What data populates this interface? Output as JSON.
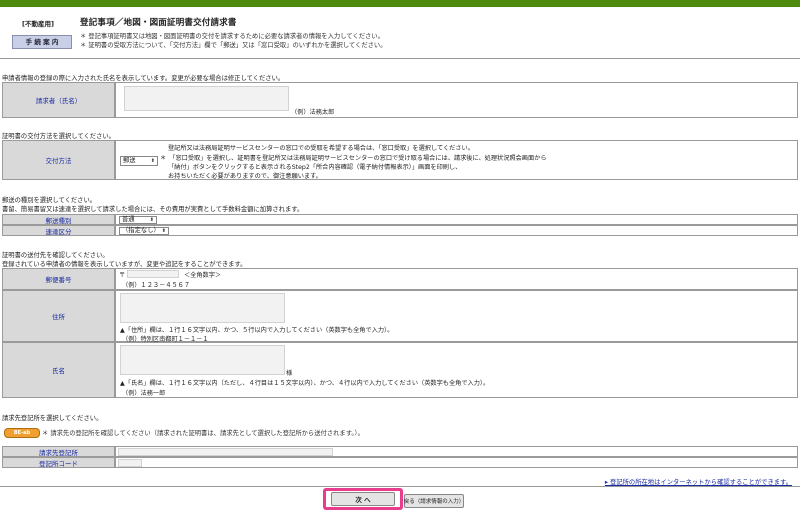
{
  "header": {
    "tag": "[不動産用]",
    "title": "登記事項／地図・図面証明書交付請求書",
    "guide_button": "手 続 案 内",
    "notes": [
      "登記事項証明書又は地図・図面証明書の交付を請求するために必要な請求者の情報を入力してください。",
      "証明書の受取方法について、「交付方法」欄で「郵送」又は「窓口受取」のいずれかを選択してください。"
    ],
    "bullet": "＊"
  },
  "applicant": {
    "intro": "申請者情報の登録の際に入力された氏名を表示しています。変更が必要な場合は修正してください。",
    "label": "請求者（氏名）",
    "example": "（例）法務太郎"
  },
  "delivery": {
    "intro": "証明書の交付方法を選択してください。",
    "label": "交付方法",
    "selected": "郵送",
    "notes": [
      "登記所又は法務局証明サービスセンターの窓口での受取を希望する場合は、「窓口受取」を選択してください。",
      "「窓口受取」を選択し、証明書を登記所又は法務局証明サービスセンターの窓口で受け取る場合には、請求後に、処理状況照会画面から",
      "「納付」ボタンをクリックすると表示されるStep2「所合内容確認（電子納付情報表示）」画面を印刷し、",
      "お持ちいただく必要がありますので、御注意願います。"
    ]
  },
  "mail_type": {
    "intro1": "郵送の種別を選択してください。",
    "intro2": "書留、簡易書留又は速達を選択して請求した場合には、その費用が実費として手数料金額に加算されます。",
    "rows": [
      {
        "label": "郵送種別",
        "selected": "普通"
      },
      {
        "label": "速達区分",
        "selected": "（指定なし）"
      }
    ]
  },
  "destination": {
    "intro1": "証明書の送付先を確認してください。",
    "intro2": "登録されている申請者の情報を表示していますが、変更や追記をすることができます。",
    "postal": {
      "label": "郵便番号",
      "prefix": "〒",
      "hint": "＜全角数字＞",
      "example": "（例）１２３－４５６７"
    },
    "address": {
      "label": "住所",
      "note": "▲「住所」欄は、１行１６文字以内、かつ、５行以内で入力してください（英数字も全角で入力）。",
      "example": "（例）特別区南都町１－１－１"
    },
    "name": {
      "label": "氏名",
      "honorific": "様",
      "note": "▲「氏名」欄は、１行１６文字以内（ただし、４行目は１５文字以内）、かつ、４行以内で入力してください（英数字も全角で入力）。",
      "example": "（例）法務一郎"
    }
  },
  "registry": {
    "intro": "請求先登記所を選択してください。",
    "pill": "BE-ab",
    "note": "請求先の登記所を確認してください（請求された証明書は、請求先として選択した登記所から送付されます。）。",
    "rows": [
      {
        "label": "請求先登記所"
      },
      {
        "label": "登記所コード"
      }
    ]
  },
  "footer": {
    "link": "登記所の所在地はインターネットから確認することができます。",
    "next": "次 へ",
    "back": "戻る（請求情報の入力）"
  }
}
